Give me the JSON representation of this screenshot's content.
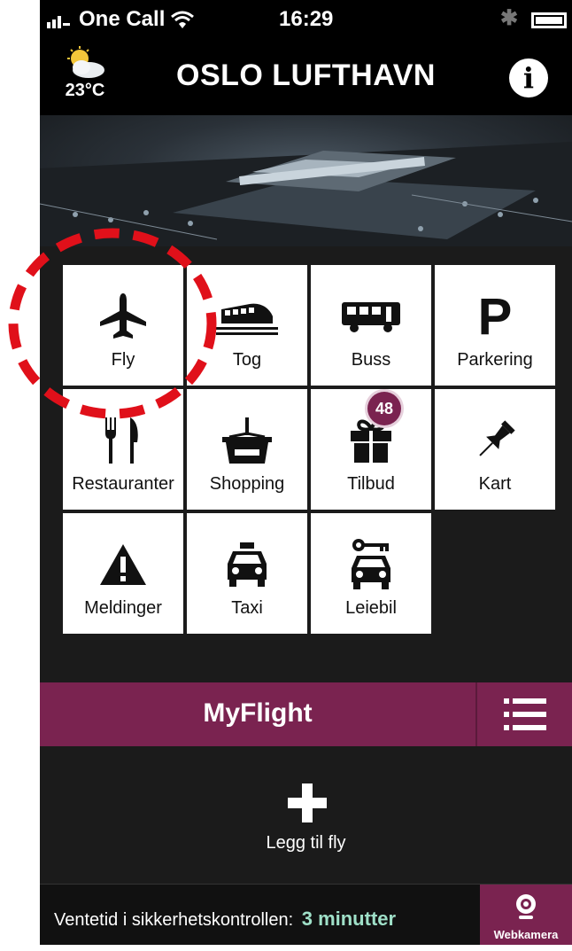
{
  "status_bar": {
    "carrier": "One Call",
    "time": "16:29"
  },
  "header": {
    "temperature": "23°C",
    "title": "OSLO LUFTHAVN",
    "weather_icon": "partly-cloudy-icon",
    "info_icon": "info-icon"
  },
  "tiles": [
    {
      "label": "Fly",
      "icon": "airplane-icon"
    },
    {
      "label": "Tog",
      "icon": "train-icon"
    },
    {
      "label": "Buss",
      "icon": "bus-icon"
    },
    {
      "label": "Parkering",
      "icon": "parking-icon"
    },
    {
      "label": "Restauranter",
      "icon": "fork-knife-icon"
    },
    {
      "label": "Shopping",
      "icon": "basket-icon"
    },
    {
      "label": "Tilbud",
      "icon": "gift-icon",
      "badge": "48"
    },
    {
      "label": "Kart",
      "icon": "pushpin-icon"
    },
    {
      "label": "Meldinger",
      "icon": "warning-icon"
    },
    {
      "label": "Taxi",
      "icon": "taxi-icon"
    },
    {
      "label": "Leiebil",
      "icon": "rental-car-icon"
    }
  ],
  "myflight": {
    "title": "MyFlight",
    "add_label": "Legg til fly"
  },
  "footer": {
    "wait_label": "Ventetid i sikkerhetskontrollen:",
    "wait_value": "3 minutter",
    "webcam_label": "Webkamera"
  },
  "colors": {
    "accent": "#7a2350",
    "annotation": "#e0101a",
    "wait_value": "#9fe0c8"
  }
}
